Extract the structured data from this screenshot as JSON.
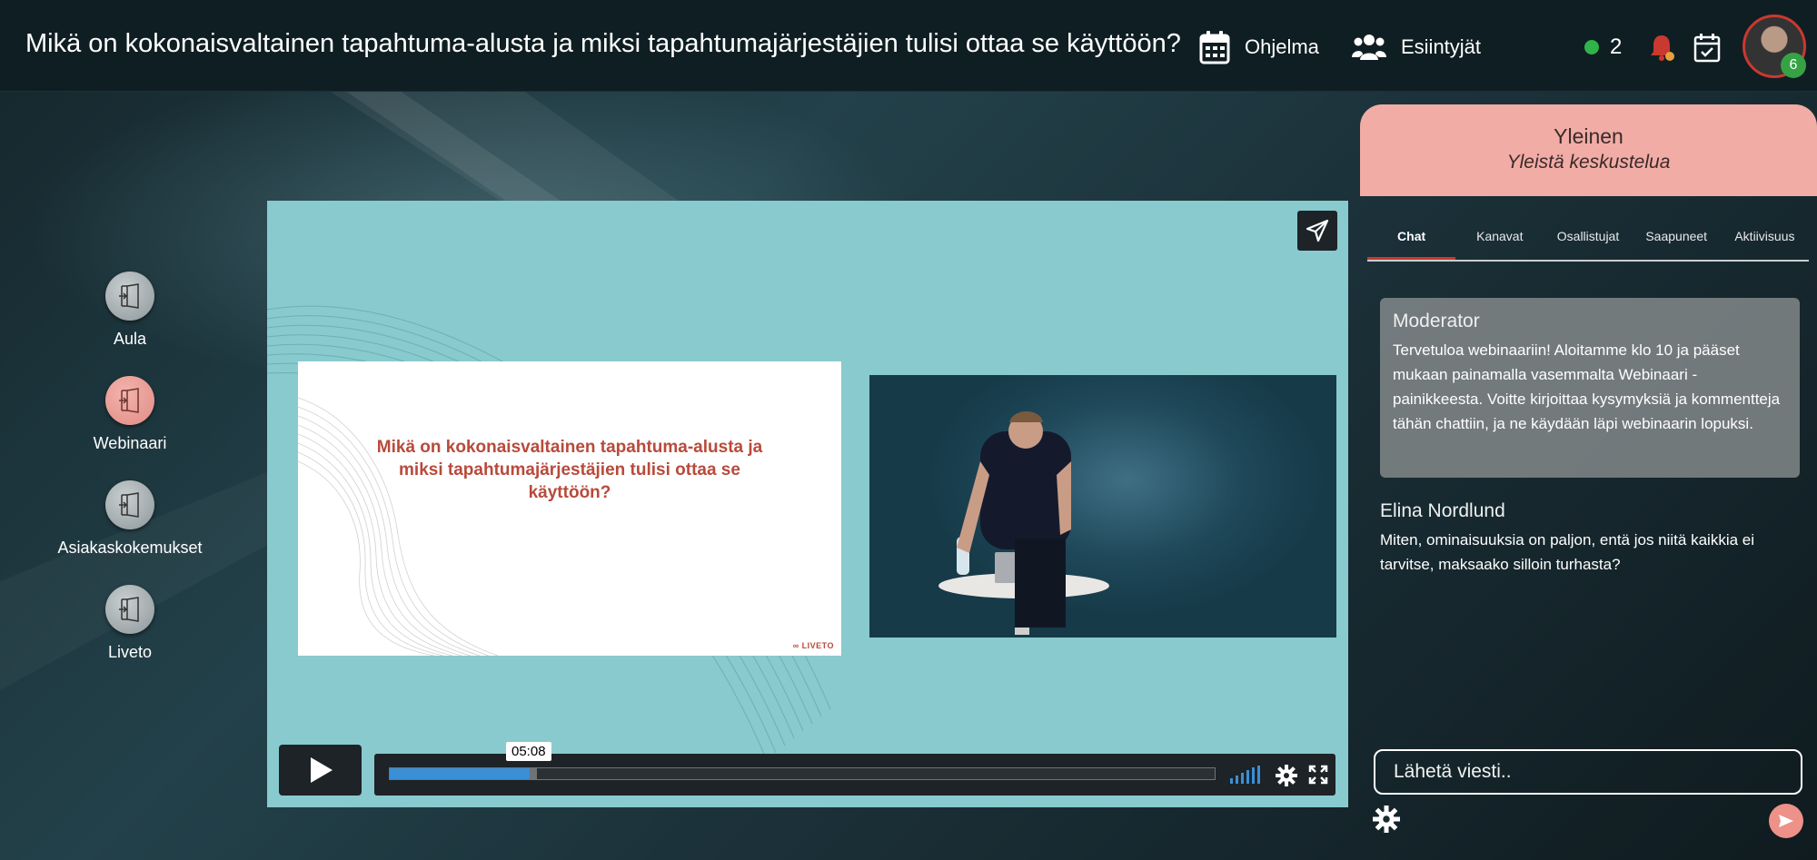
{
  "header": {
    "title": "Mikä on kokonaisvaltainen tapahtuma-alusta ja miksi tapahtumajärjestäjien tulisi ottaa se käyttöön?",
    "nav": [
      {
        "label": "Ohjelma",
        "icon": "calendar-icon"
      },
      {
        "label": "Esiintyjät",
        "icon": "users-icon"
      }
    ],
    "online_count": "2",
    "avatar_badge": "6",
    "icons": [
      "bell-icon",
      "calendar-check-icon"
    ],
    "colors": {
      "online": "#2fb34a",
      "bell": "#c9392f",
      "badge": "#36a244"
    }
  },
  "rooms": [
    {
      "label": "Aula",
      "active": false
    },
    {
      "label": "Webinaari",
      "active": true
    },
    {
      "label": "Asiakaskokemukset",
      "active": false
    },
    {
      "label": "Liveto",
      "active": false
    }
  ],
  "player": {
    "slide_title": "Mikä on kokonaisvaltainen tapahtuma-alusta ja miksi tapahtumajärjestäjien tulisi ottaa se käyttöön?",
    "slide_logo": "∞ LIVETO",
    "time_tooltip": "05:08",
    "progress_fraction": 0.17,
    "buffer_fraction": 0.18,
    "background_color": "#88cace"
  },
  "chat": {
    "channel_name": "Yleinen",
    "channel_description": "Yleistä keskustelua",
    "tabs": [
      "Chat",
      "Kanavat",
      "Osallistujat",
      "Saapuneet",
      "Aktiivisuus"
    ],
    "active_tab": "Chat",
    "messages": [
      {
        "author": "Moderator",
        "text": "Tervetuloa webinaariin! Aloitamme klo 10 ja pääset mukaan painamalla vasemmalta Webinaari -painikkeesta. Voitte kirjoittaa kysymyksiä ja kommentteja tähän chattiin, ja ne käydään läpi webinaarin lopuksi."
      },
      {
        "author": "Elina Nordlund",
        "text": "Miten, ominaisuuksia on paljon, entä jos niitä kaikkia ei tarvitse, maksaako silloin turhasta?"
      }
    ],
    "input_placeholder": "Lähetä viesti..",
    "header_color": "#f1aca5"
  }
}
